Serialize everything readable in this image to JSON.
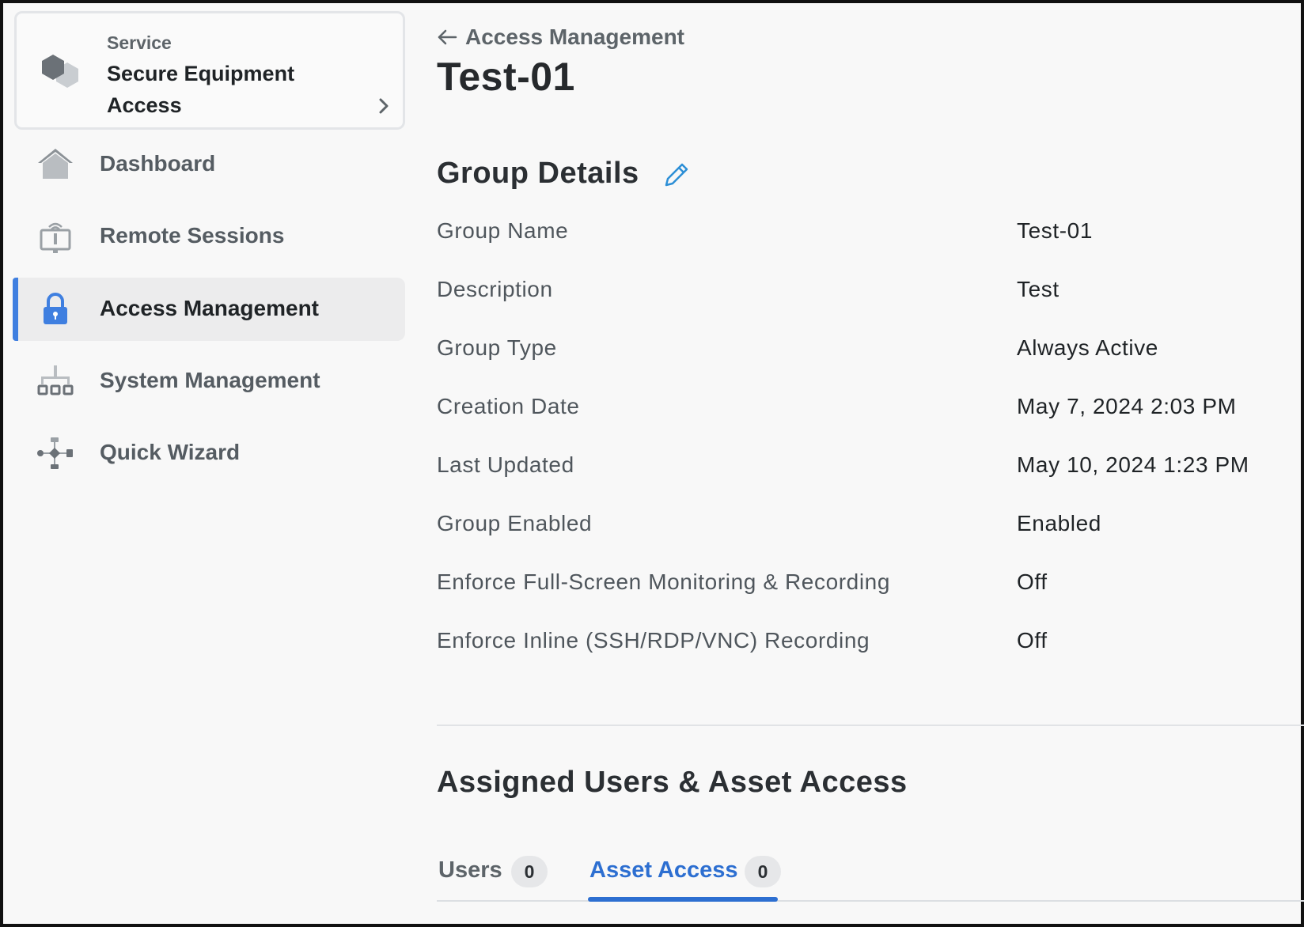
{
  "sidebar": {
    "service": {
      "kicker": "Service",
      "name": "Secure Equipment Access",
      "icon": "hexagon-logo-icon"
    },
    "items": [
      {
        "label": "Dashboard",
        "icon": "home-icon",
        "active": false
      },
      {
        "label": "Remote Sessions",
        "icon": "remote-monitor-icon",
        "active": false
      },
      {
        "label": "Access Management",
        "icon": "lock-icon",
        "active": true
      },
      {
        "label": "System Management",
        "icon": "network-tree-icon",
        "active": false
      },
      {
        "label": "Quick Wizard",
        "icon": "workflow-icon",
        "active": false
      }
    ],
    "accent_color": "#3f7fe0"
  },
  "main": {
    "breadcrumb": "Access Management",
    "page_title": "Test-01",
    "details": {
      "title": "Group Details",
      "rows": [
        {
          "label": "Group Name",
          "value": "Test-01"
        },
        {
          "label": "Description",
          "value": "Test"
        },
        {
          "label": "Group Type",
          "value": "Always Active"
        },
        {
          "label": "Creation Date",
          "value": "May 7, 2024 2:03 PM"
        },
        {
          "label": "Last Updated",
          "value": "May 10, 2024 1:23 PM"
        },
        {
          "label": "Group Enabled",
          "value": "Enabled"
        },
        {
          "label": "Enforce Full-Screen Monitoring & Recording",
          "value": "Off"
        },
        {
          "label": "Enforce Inline (SSH/RDP/VNC) Recording",
          "value": "Off"
        }
      ]
    },
    "assigned": {
      "title": "Assigned Users & Asset Access",
      "tabs": [
        {
          "label": "Users",
          "count": "0",
          "active": false
        },
        {
          "label": "Asset Access",
          "count": "0",
          "active": true
        }
      ]
    },
    "link_color": "#2d6fd1"
  }
}
